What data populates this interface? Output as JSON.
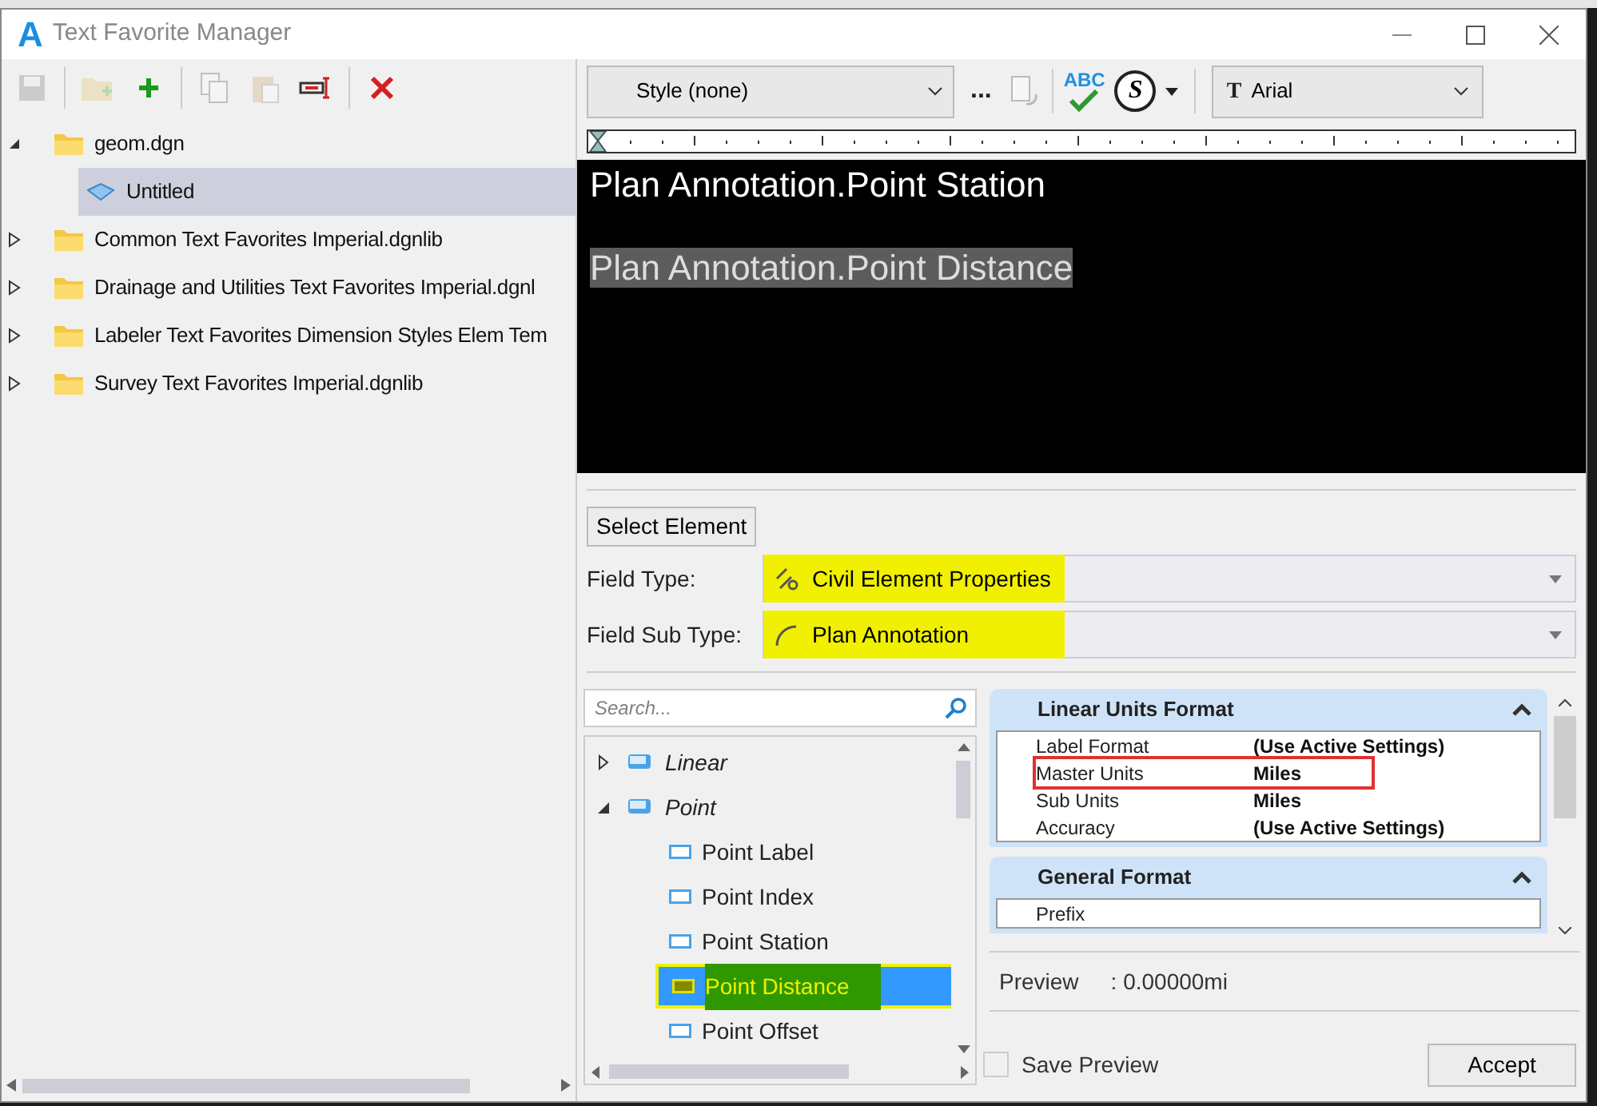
{
  "window": {
    "logo": "A",
    "title": "Text Favorite Manager"
  },
  "toolbar": [
    {
      "kind": "save",
      "disabled": true
    },
    {
      "kind": "new-folder",
      "disabled": true
    },
    {
      "kind": "add",
      "disabled": false
    },
    {
      "kind": "copy",
      "disabled": true
    },
    {
      "kind": "paste",
      "disabled": true
    },
    {
      "kind": "rename",
      "disabled": false
    },
    {
      "kind": "delete",
      "disabled": false
    }
  ],
  "tree": [
    {
      "label": "geom.dgn",
      "kind": "folder",
      "expanded": true,
      "selected": false,
      "children": [
        {
          "label": "Untitled",
          "kind": "favorite",
          "selected": true
        }
      ]
    },
    {
      "label": "Common Text Favorites Imperial.dgnlib",
      "kind": "folder",
      "expanded": false,
      "selected": false
    },
    {
      "label": "Drainage and Utilities Text Favorites Imperial.dgnl",
      "kind": "folder",
      "expanded": false,
      "selected": false
    },
    {
      "label": "Labeler Text Favorites Dimension Styles Elem Tem",
      "kind": "folder",
      "expanded": false,
      "selected": false
    },
    {
      "label": "Survey Text Favorites Imperial.dgnlib",
      "kind": "folder",
      "expanded": false,
      "selected": false
    }
  ],
  "editor_toolbar": {
    "style": "Style (none)",
    "more": "...",
    "spellcheck_text": "ABC",
    "symbol_text": "S",
    "font_icon_text": "T",
    "font": "Arial"
  },
  "editor": {
    "lines": [
      {
        "text": "Plan Annotation.Point Station",
        "selected": false
      },
      {
        "text": "Plan Annotation.Point Distance",
        "selected": true
      }
    ]
  },
  "select_element_button": "Select Element",
  "fields": [
    {
      "label": "Field Type:",
      "value": "Civil Element Properties",
      "kind": "civil",
      "highlighted": true
    },
    {
      "label": "Field Sub Type:",
      "value": "Plan Annotation",
      "kind": "arc",
      "highlighted": true
    }
  ],
  "search": {
    "placeholder": "Search..."
  },
  "field_tree": [
    {
      "label": "Linear",
      "expanded": false
    },
    {
      "label": "Point",
      "expanded": true,
      "children": [
        {
          "label": "Point Label",
          "selected": false,
          "highlighted": false
        },
        {
          "label": "Point Index",
          "selected": false,
          "highlighted": false
        },
        {
          "label": "Point Station",
          "selected": false,
          "highlighted": false
        },
        {
          "label": "Point Distance",
          "selected": true,
          "highlighted": true
        },
        {
          "label": "Point Offset",
          "selected": false,
          "highlighted": false
        }
      ]
    }
  ],
  "properties": [
    {
      "title": "Linear Units Format",
      "expanded": true,
      "rows": [
        {
          "label": "Label Format",
          "value": "(Use Active Settings)",
          "outlined": false
        },
        {
          "label": "Master Units",
          "value": "Miles",
          "outlined": true
        },
        {
          "label": "Sub Units",
          "value": "Miles",
          "outlined": false
        },
        {
          "label": "Accuracy",
          "value": "(Use Active Settings)",
          "outlined": false
        }
      ]
    },
    {
      "title": "General Format",
      "expanded": true,
      "rows": [
        {
          "label": "Prefix",
          "outlined": false
        }
      ]
    }
  ],
  "preview": {
    "label": "Preview",
    "value": ": 0.00000mi"
  },
  "save_preview": {
    "label": "Save Preview",
    "checked": false
  },
  "accept_button": "Accept"
}
